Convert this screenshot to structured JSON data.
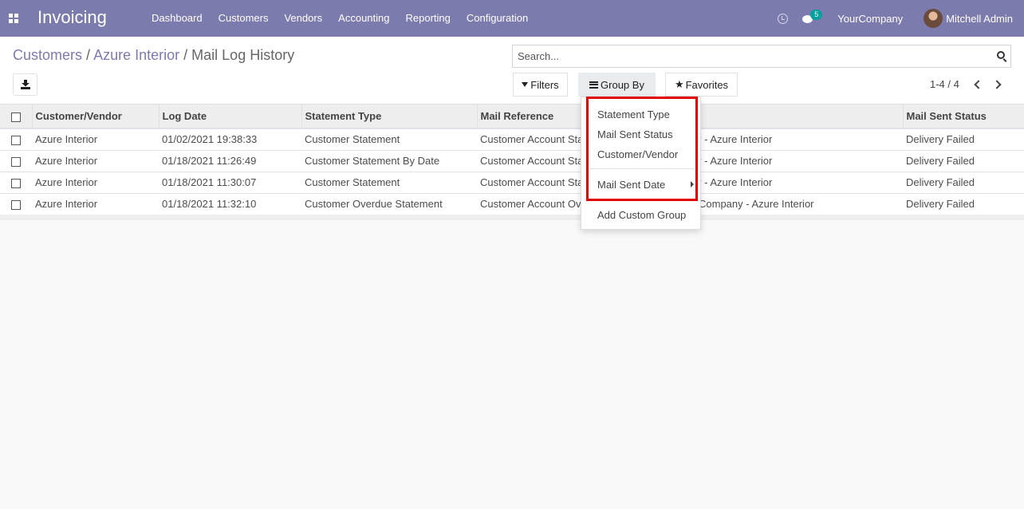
{
  "navbar": {
    "app_title": "Invoicing",
    "menu": [
      "Dashboard",
      "Customers",
      "Vendors",
      "Accounting",
      "Reporting",
      "Configuration"
    ],
    "chat_count": "5",
    "company": "YourCompany",
    "user": "Mitchell Admin",
    "bg_color": "#7c7bad"
  },
  "breadcrumb": {
    "items": [
      "Customers",
      "Azure Interior"
    ],
    "separator": "/",
    "current": "Mail Log History"
  },
  "search": {
    "placeholder": "Search..."
  },
  "buttons": {
    "filters": "Filters",
    "group_by": "Group By",
    "favorites": "Favorites"
  },
  "pager": {
    "text": "1-4 / 4"
  },
  "table": {
    "columns": [
      "Customer/Vendor",
      "Log Date",
      "Statement Type",
      "Mail Reference",
      "Mail Sent Status"
    ],
    "rows": [
      {
        "customer": "Azure Interior",
        "log_date": "01/02/2021 19:38:33",
        "statement_type": "Customer Statement",
        "mail_ref_start": "Customer Account Sta",
        "mail_ref_end": "y - Azure Interior",
        "status": "Delivery Failed"
      },
      {
        "customer": "Azure Interior",
        "log_date": "01/18/2021 11:26:49",
        "statement_type": "Customer Statement By Date",
        "mail_ref_start": "Customer Account Sta",
        "mail_ref_end": "y - Azure Interior",
        "status": "Delivery Failed"
      },
      {
        "customer": "Azure Interior",
        "log_date": "01/18/2021 11:30:07",
        "statement_type": "Customer Statement",
        "mail_ref_start": "Customer Account Sta",
        "mail_ref_end": "y - Azure Interior",
        "status": "Delivery Failed"
      },
      {
        "customer": "Azure Interior",
        "log_date": "01/18/2021 11:32:10",
        "statement_type": "Customer Overdue Statement",
        "mail_ref_start": "Customer Account Ov",
        "mail_ref_end": "Company - Azure Interior",
        "status": "Delivery Failed"
      }
    ]
  },
  "group_by_menu": {
    "items": [
      "Statement Type",
      "Mail Sent Status",
      "Customer/Vendor"
    ],
    "date_item": "Mail Sent Date",
    "custom": "Add Custom Group",
    "highlight_color": "#e00000"
  }
}
